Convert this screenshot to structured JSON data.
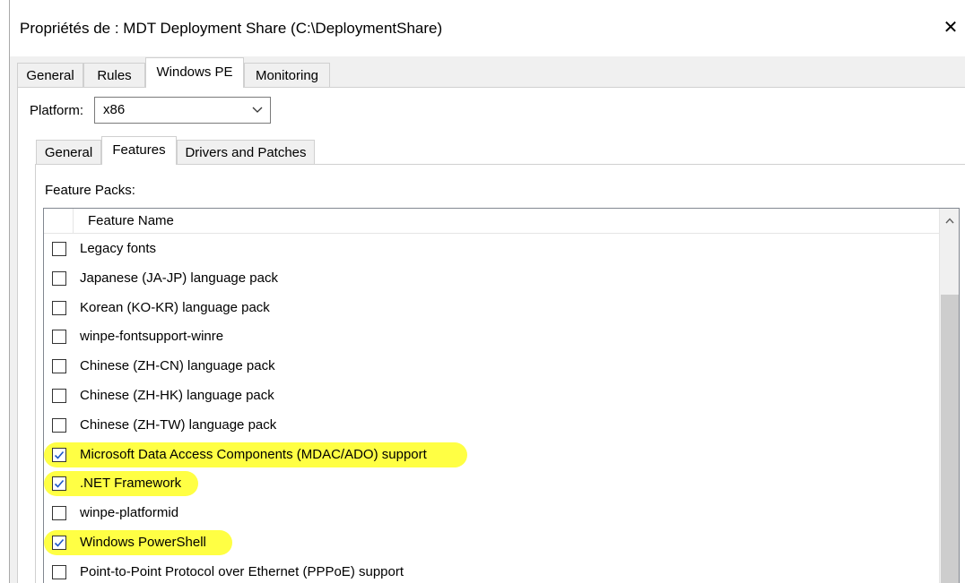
{
  "window": {
    "title": "Propriétés de : MDT Deployment Share (C:\\DeploymentShare)",
    "close_glyph": "✕"
  },
  "tabs_top": [
    {
      "label": "General",
      "active": false
    },
    {
      "label": "Rules",
      "active": false
    },
    {
      "label": "Windows PE",
      "active": true
    },
    {
      "label": "Monitoring",
      "active": false
    }
  ],
  "platform": {
    "label": "Platform:",
    "value": "x86"
  },
  "tabs_inner": [
    {
      "label": "General",
      "active": false
    },
    {
      "label": "Features",
      "active": true
    },
    {
      "label": "Drivers and Patches",
      "active": false
    }
  ],
  "feature_packs": {
    "label": "Feature Packs:",
    "column_header": "Feature Name",
    "items": [
      {
        "label": "Legacy fonts",
        "checked": false,
        "highlighted": false
      },
      {
        "label": "Japanese (JA-JP) language pack",
        "checked": false,
        "highlighted": false
      },
      {
        "label": "Korean (KO-KR) language pack",
        "checked": false,
        "highlighted": false
      },
      {
        "label": "winpe-fontsupport-winre",
        "checked": false,
        "highlighted": false
      },
      {
        "label": "Chinese (ZH-CN) language pack",
        "checked": false,
        "highlighted": false
      },
      {
        "label": "Chinese (ZH-HK) language pack",
        "checked": false,
        "highlighted": false
      },
      {
        "label": "Chinese (ZH-TW) language pack",
        "checked": false,
        "highlighted": false
      },
      {
        "label": "Microsoft Data Access Components (MDAC/ADO) support",
        "checked": true,
        "highlighted": true
      },
      {
        "label": ".NET Framework",
        "checked": true,
        "highlighted": true
      },
      {
        "label": "winpe-platformid",
        "checked": false,
        "highlighted": false
      },
      {
        "label": "Windows PowerShell",
        "checked": true,
        "highlighted": true
      },
      {
        "label": "Point-to-Point Protocol over Ethernet (PPPoE) support",
        "checked": false,
        "highlighted": false
      }
    ]
  },
  "colors": {
    "highlight": "#ffff3a",
    "check": "#1a56c4"
  }
}
